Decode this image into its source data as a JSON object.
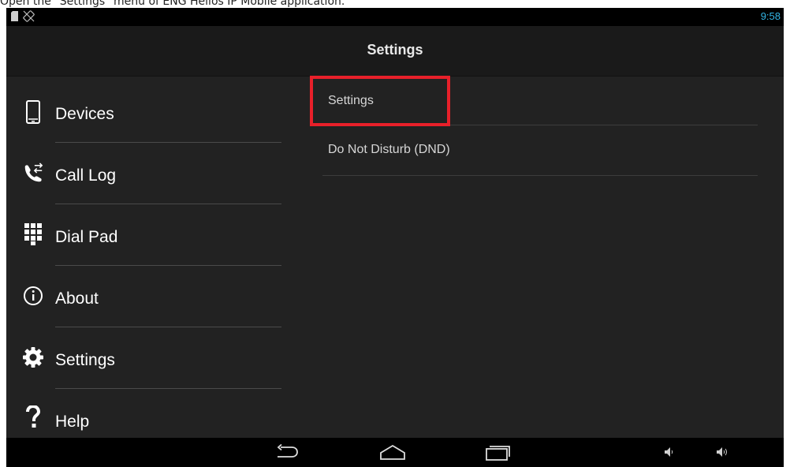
{
  "caption": "Open the \"Settings\" menu of ENG Helios IP Mobile application.",
  "status_bar": {
    "time": "9:58",
    "icons": [
      "sd-card-icon",
      "no-rotation-icon"
    ]
  },
  "action_bar": {
    "title": "Settings"
  },
  "sidebar": {
    "items": [
      {
        "label": "Devices",
        "icon": "phone-icon"
      },
      {
        "label": "Call Log",
        "icon": "call-log-icon"
      },
      {
        "label": "Dial Pad",
        "icon": "dialpad-icon"
      },
      {
        "label": "About",
        "icon": "info-icon"
      },
      {
        "label": "Settings",
        "icon": "gear-icon"
      },
      {
        "label": "Help",
        "icon": "question-icon"
      }
    ]
  },
  "content": {
    "items": [
      {
        "label": "Settings",
        "highlighted": true
      },
      {
        "label": "Do Not Disturb (DND)"
      }
    ]
  },
  "nav_bar": {
    "buttons": [
      "back-icon",
      "home-icon",
      "recents-icon"
    ],
    "volume": [
      "volume-down-icon",
      "volume-up-icon"
    ]
  },
  "colors": {
    "background": "#222222",
    "action_bar": "#1a1a1a",
    "status_time": "#33b5e5",
    "highlight_border": "#e8202a"
  }
}
